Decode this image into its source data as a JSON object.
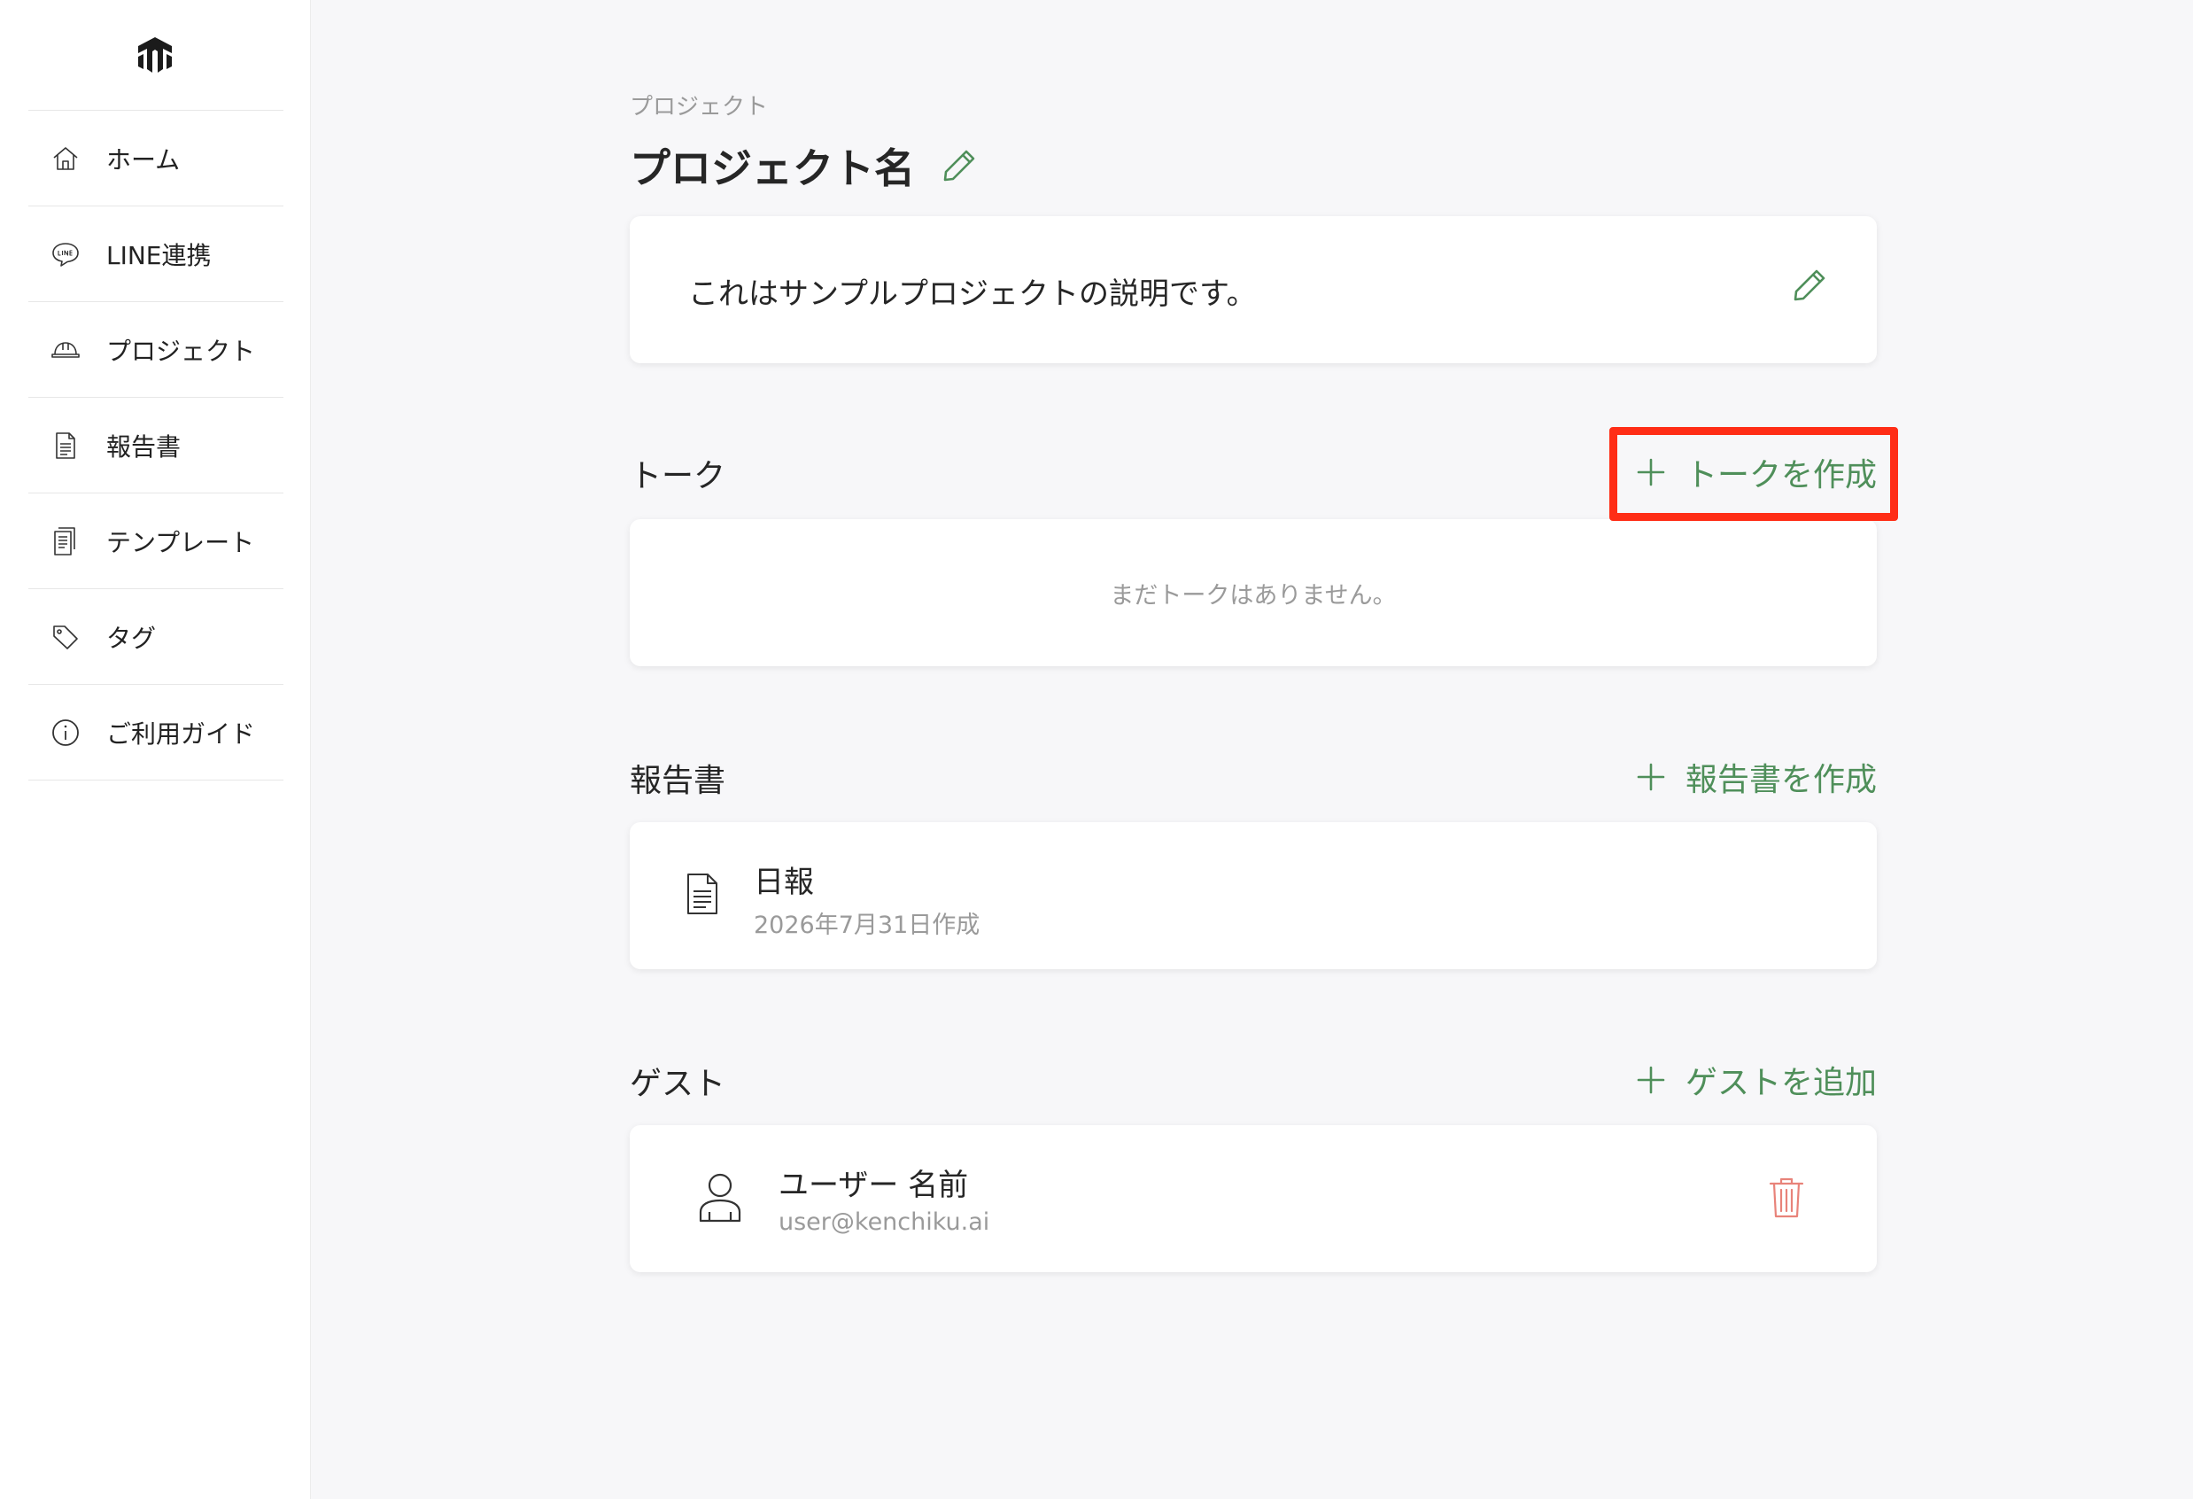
{
  "colors": {
    "accent": "#4f8f5a",
    "delete": "#e8837a",
    "highlight": "#ff2d16",
    "muted_text": "#9a9a9a"
  },
  "sidebar": {
    "logo_icon": "kenchiku-logo-icon",
    "items": [
      {
        "label": "ホーム",
        "icon": "home-icon"
      },
      {
        "label": "LINE連携",
        "icon": "line-chat-icon"
      },
      {
        "label": "プロジェクト",
        "icon": "hard-hat-icon"
      },
      {
        "label": "報告書",
        "icon": "document-icon"
      },
      {
        "label": "テンプレート",
        "icon": "template-stack-icon"
      },
      {
        "label": "タグ",
        "icon": "tag-icon"
      },
      {
        "label": "ご利用ガイド",
        "icon": "info-icon"
      }
    ]
  },
  "main": {
    "breadcrumb": "プロジェクト",
    "title": "プロジェクト名",
    "description": "これはサンプルプロジェクトの説明です。",
    "talk": {
      "heading": "トーク",
      "add_label": "トークを作成",
      "empty_message": "まだトークはありません。"
    },
    "reports": {
      "heading": "報告書",
      "add_label": "報告書を作成",
      "items": [
        {
          "title": "日報",
          "date": "2026年7月31日作成"
        }
      ]
    },
    "guests": {
      "heading": "ゲスト",
      "add_label": "ゲストを追加",
      "items": [
        {
          "name": "ユーザー 名前",
          "email": "user@kenchiku.ai"
        }
      ]
    }
  }
}
